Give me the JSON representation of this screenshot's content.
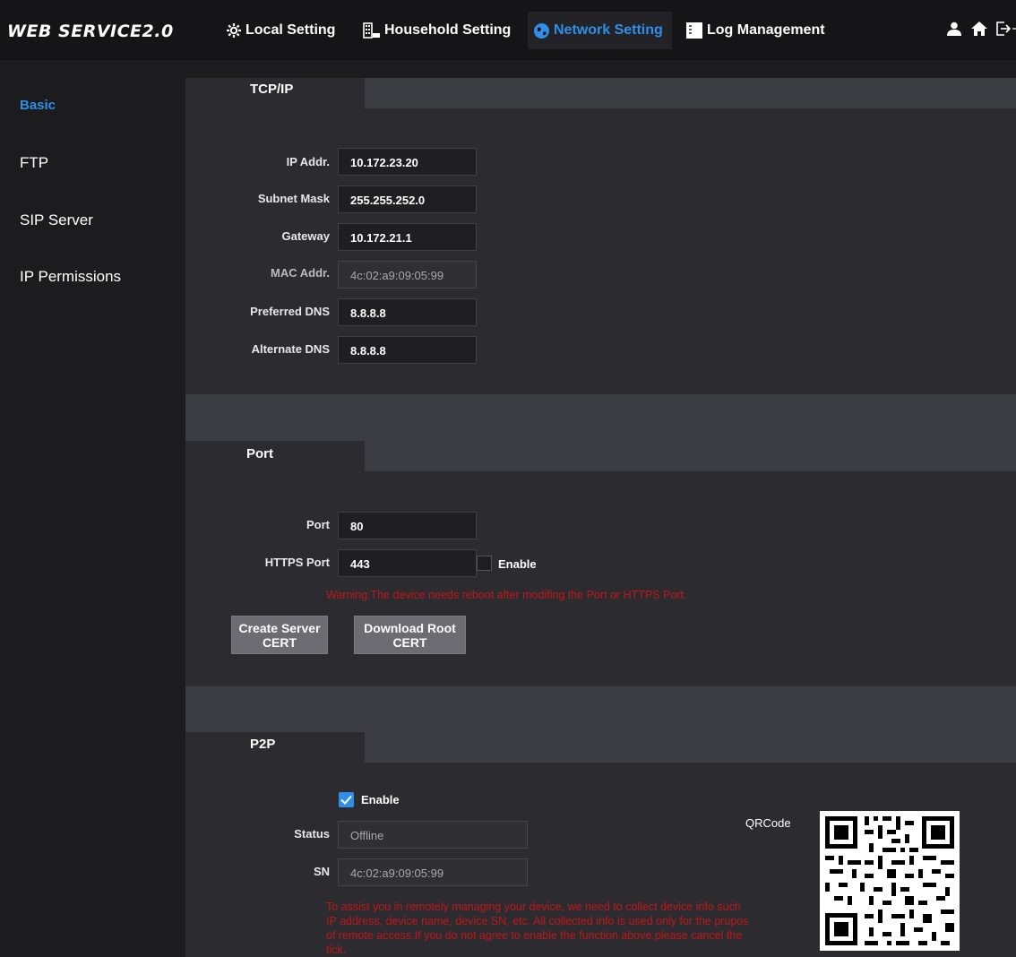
{
  "app": {
    "title": "WEB SERVICE2.0"
  },
  "nav": {
    "local": "Local Setting",
    "household": "Household Setting",
    "network": "Network Setting",
    "log": "Log Management"
  },
  "sidebar": {
    "items": [
      {
        "label": "Basic",
        "active": true
      },
      {
        "label": "FTP"
      },
      {
        "label": "SIP Server"
      },
      {
        "label": "IP Permissions"
      }
    ]
  },
  "tcpip": {
    "title": "TCP/IP",
    "ip_label": "IP Addr.",
    "ip_value": "10.172.23.20",
    "mask_label": "Subnet Mask",
    "mask_value": "255.255.252.0",
    "gw_label": "Gateway",
    "gw_value": "10.172.21.1",
    "mac_label": "MAC Addr.",
    "mac_value": "4c:02:a9:09:05:99",
    "dns1_label": "Preferred DNS",
    "dns1_value": "8.8.8.8",
    "dns2_label": "Alternate DNS",
    "dns2_value": "8.8.8.8"
  },
  "port": {
    "title": "Port",
    "port_label": "Port",
    "port_value": "80",
    "https_label": "HTTPS Port",
    "https_value": "443",
    "https_enable_label": "Enable",
    "warning": "Warning:The device needs reboot after modifing the Port or HTTPS Port.",
    "create_btn_1": "Create Server",
    "create_btn_2": "CERT",
    "download_btn_1": "Download Root",
    "download_btn_2": "CERT"
  },
  "p2p": {
    "title": "P2P",
    "enable_label": "Enable",
    "status_label": "Status",
    "status_value": "Offline",
    "sn_label": "SN",
    "sn_value": "4c:02:a9:09:05:99",
    "qrcode_label": "QRCode",
    "notice_1": "To assist you in remotely managing your device, we need to collect device info such",
    "notice_2": "IP address, device name, device SN, etc. All collected info is used only for the prupos",
    "notice_3": "of remote access.If you do not agree to enable the function above,please cancel the",
    "notice_4": "tick."
  },
  "colors": {
    "accent": "#2f8fe8",
    "warning": "#c0161a",
    "panel": "#2c2c30",
    "band": "#3c3c43"
  }
}
